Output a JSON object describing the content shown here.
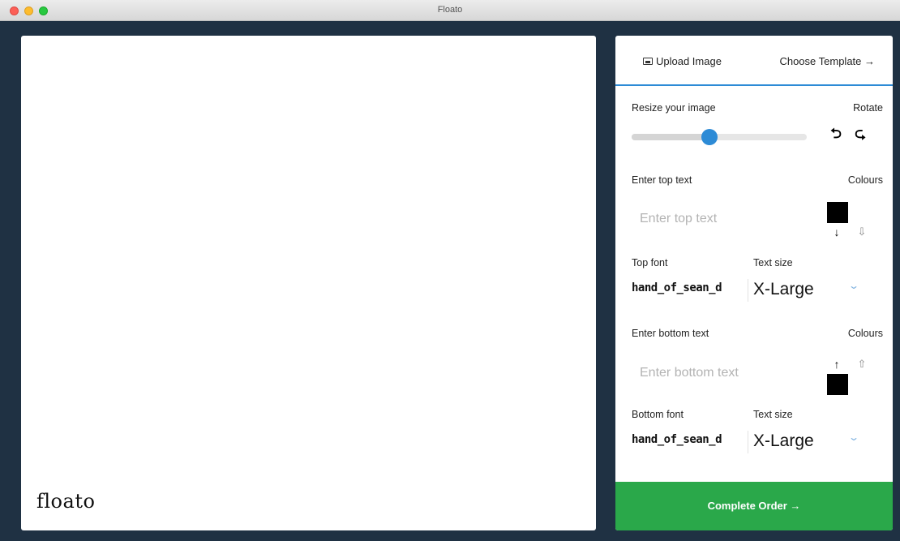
{
  "window": {
    "title": "Floato"
  },
  "canvas": {
    "logo_text": "floato"
  },
  "tabs": {
    "upload_label": "Upload Image",
    "template_label": "Choose Template →"
  },
  "resize": {
    "label": "Resize your image",
    "value_fraction": 0.27
  },
  "rotate": {
    "label": "Rotate",
    "left_icon": "⮌",
    "right_icon": "⮎"
  },
  "top_text": {
    "label": "Enter top text",
    "placeholder": "Enter top text",
    "colours_label": "Colours",
    "colour": "#000000",
    "position_down_icon": "↓",
    "position_anchor_icon": "⇩"
  },
  "top_font": {
    "font_label": "Top font",
    "size_label": "Text size",
    "font_value": "hand_of_sean_d",
    "size_value": "X-Large"
  },
  "bottom_text": {
    "label": "Enter bottom text",
    "placeholder": "Enter bottom text",
    "colours_label": "Colours",
    "colour": "#000000",
    "position_up_icon": "↑",
    "position_anchor_icon": "⇧"
  },
  "bottom_font": {
    "font_label": "Bottom font",
    "size_label": "Text size",
    "font_value": "hand_of_sean_d",
    "size_value": "X-Large"
  },
  "order": {
    "button_label": "Complete Order →"
  },
  "colors": {
    "accent": "#2d8bd6",
    "order_green": "#2aa84a",
    "window_bg": "#1f3143"
  }
}
